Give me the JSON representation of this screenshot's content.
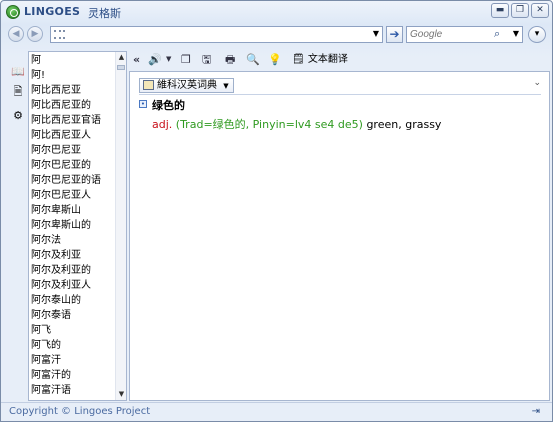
{
  "window": {
    "app_name": "LINGOES",
    "app_name_cn": "灵格斯",
    "minimize_glyph": "▬",
    "restore_glyph": "❐",
    "close_glyph": "✕"
  },
  "toolbar": {
    "back_glyph": "◀",
    "forward_glyph": "▶",
    "query_value": "",
    "dropdown_glyph": "▼",
    "go_glyph": "➔",
    "search_placeholder": "Google",
    "search_icon_glyph": "⌕",
    "menu_glyph": "▾"
  },
  "word_list": {
    "items": [
      "阿",
      "阿!",
      "阿比西尼亚",
      "阿比西尼亚的",
      "阿比西尼亚官语",
      "阿比西尼亚人",
      "阿尔巴尼亚",
      "阿尔巴尼亚的",
      "阿尔巴尼亚的语",
      "阿尔巴尼亚人",
      "阿尔卑斯山",
      "阿尔卑斯山的",
      "阿尔法",
      "阿尔及利亚",
      "阿尔及利亚的",
      "阿尔及利亚人",
      "阿尔泰山的",
      "阿尔泰语",
      "阿飞",
      "阿飞的",
      "阿富汗",
      "阿富汗的",
      "阿富汗语"
    ]
  },
  "result_toolbar": {
    "translate_label": "文本翻译"
  },
  "result": {
    "dictionary_tab": "維科汉英词典",
    "headword": "绿色的",
    "pos": "adj.",
    "open_paren": " (",
    "trad_label": "Trad",
    "trad_value": "=绿色的, ",
    "pinyin_label": "Pinyin",
    "pinyin_value": "=lv4 se4 de5",
    "close_paren": ")",
    "gloss": " green, grassy"
  },
  "status": {
    "copyright": "Copyright © Lingoes Project"
  }
}
